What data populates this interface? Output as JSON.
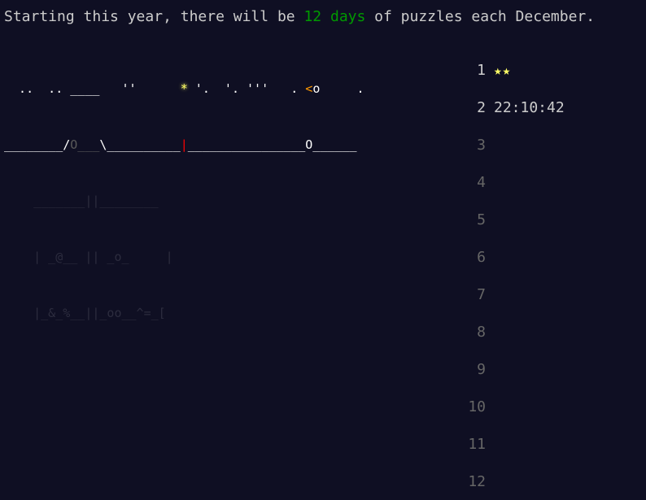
{
  "intro": {
    "prefix": "Starting this year, there will be ",
    "highlight": "12 days",
    "suffix": " of puzzles each December."
  },
  "art": {
    "row0": [
      {
        "t": "  ..  .. ____   ''      ",
        "c": "white"
      },
      {
        "t": "*",
        "c": "star"
      },
      {
        "t": " '.  '. '''   . ",
        "c": "white"
      },
      {
        "t": "<",
        "c": "orange"
      },
      {
        "t": "o",
        "c": "white"
      },
      {
        "t": "     .",
        "c": "white"
      }
    ],
    "row1": [
      {
        "t": "________/",
        "c": "white"
      },
      {
        "t": "O___",
        "c": "dim"
      },
      {
        "t": "\\__________",
        "c": "white"
      },
      {
        "t": "|",
        "c": "red"
      },
      {
        "t": "________________O______",
        "c": "white"
      }
    ],
    "row2": [
      {
        "t": "    _______||________",
        "c": "faint"
      }
    ],
    "row3": [
      {
        "t": "    | _@__ || _o_     |",
        "c": "faint"
      }
    ],
    "row4": [
      {
        "t": "    |_&_%__||_oo__^=_[",
        "c": "faint"
      }
    ]
  },
  "calendar": {
    "days": [
      {
        "num": "1",
        "value": "★★",
        "kind": "stars"
      },
      {
        "num": "2",
        "value": "22:10:42",
        "kind": "time"
      },
      {
        "num": "3",
        "value": "",
        "kind": "empty"
      },
      {
        "num": "4",
        "value": "",
        "kind": "empty"
      },
      {
        "num": "5",
        "value": "",
        "kind": "empty"
      },
      {
        "num": "6",
        "value": "",
        "kind": "empty"
      },
      {
        "num": "7",
        "value": "",
        "kind": "empty"
      },
      {
        "num": "8",
        "value": "",
        "kind": "empty"
      },
      {
        "num": "9",
        "value": "",
        "kind": "empty"
      },
      {
        "num": "10",
        "value": "",
        "kind": "empty"
      },
      {
        "num": "11",
        "value": "",
        "kind": "empty"
      },
      {
        "num": "12",
        "value": "",
        "kind": "empty"
      }
    ]
  },
  "colors": {
    "background": "#0f0f23",
    "text": "#cccccc",
    "green": "#009900",
    "star": "#ffff66",
    "orange": "#ff9900",
    "red": "#ff0000"
  }
}
